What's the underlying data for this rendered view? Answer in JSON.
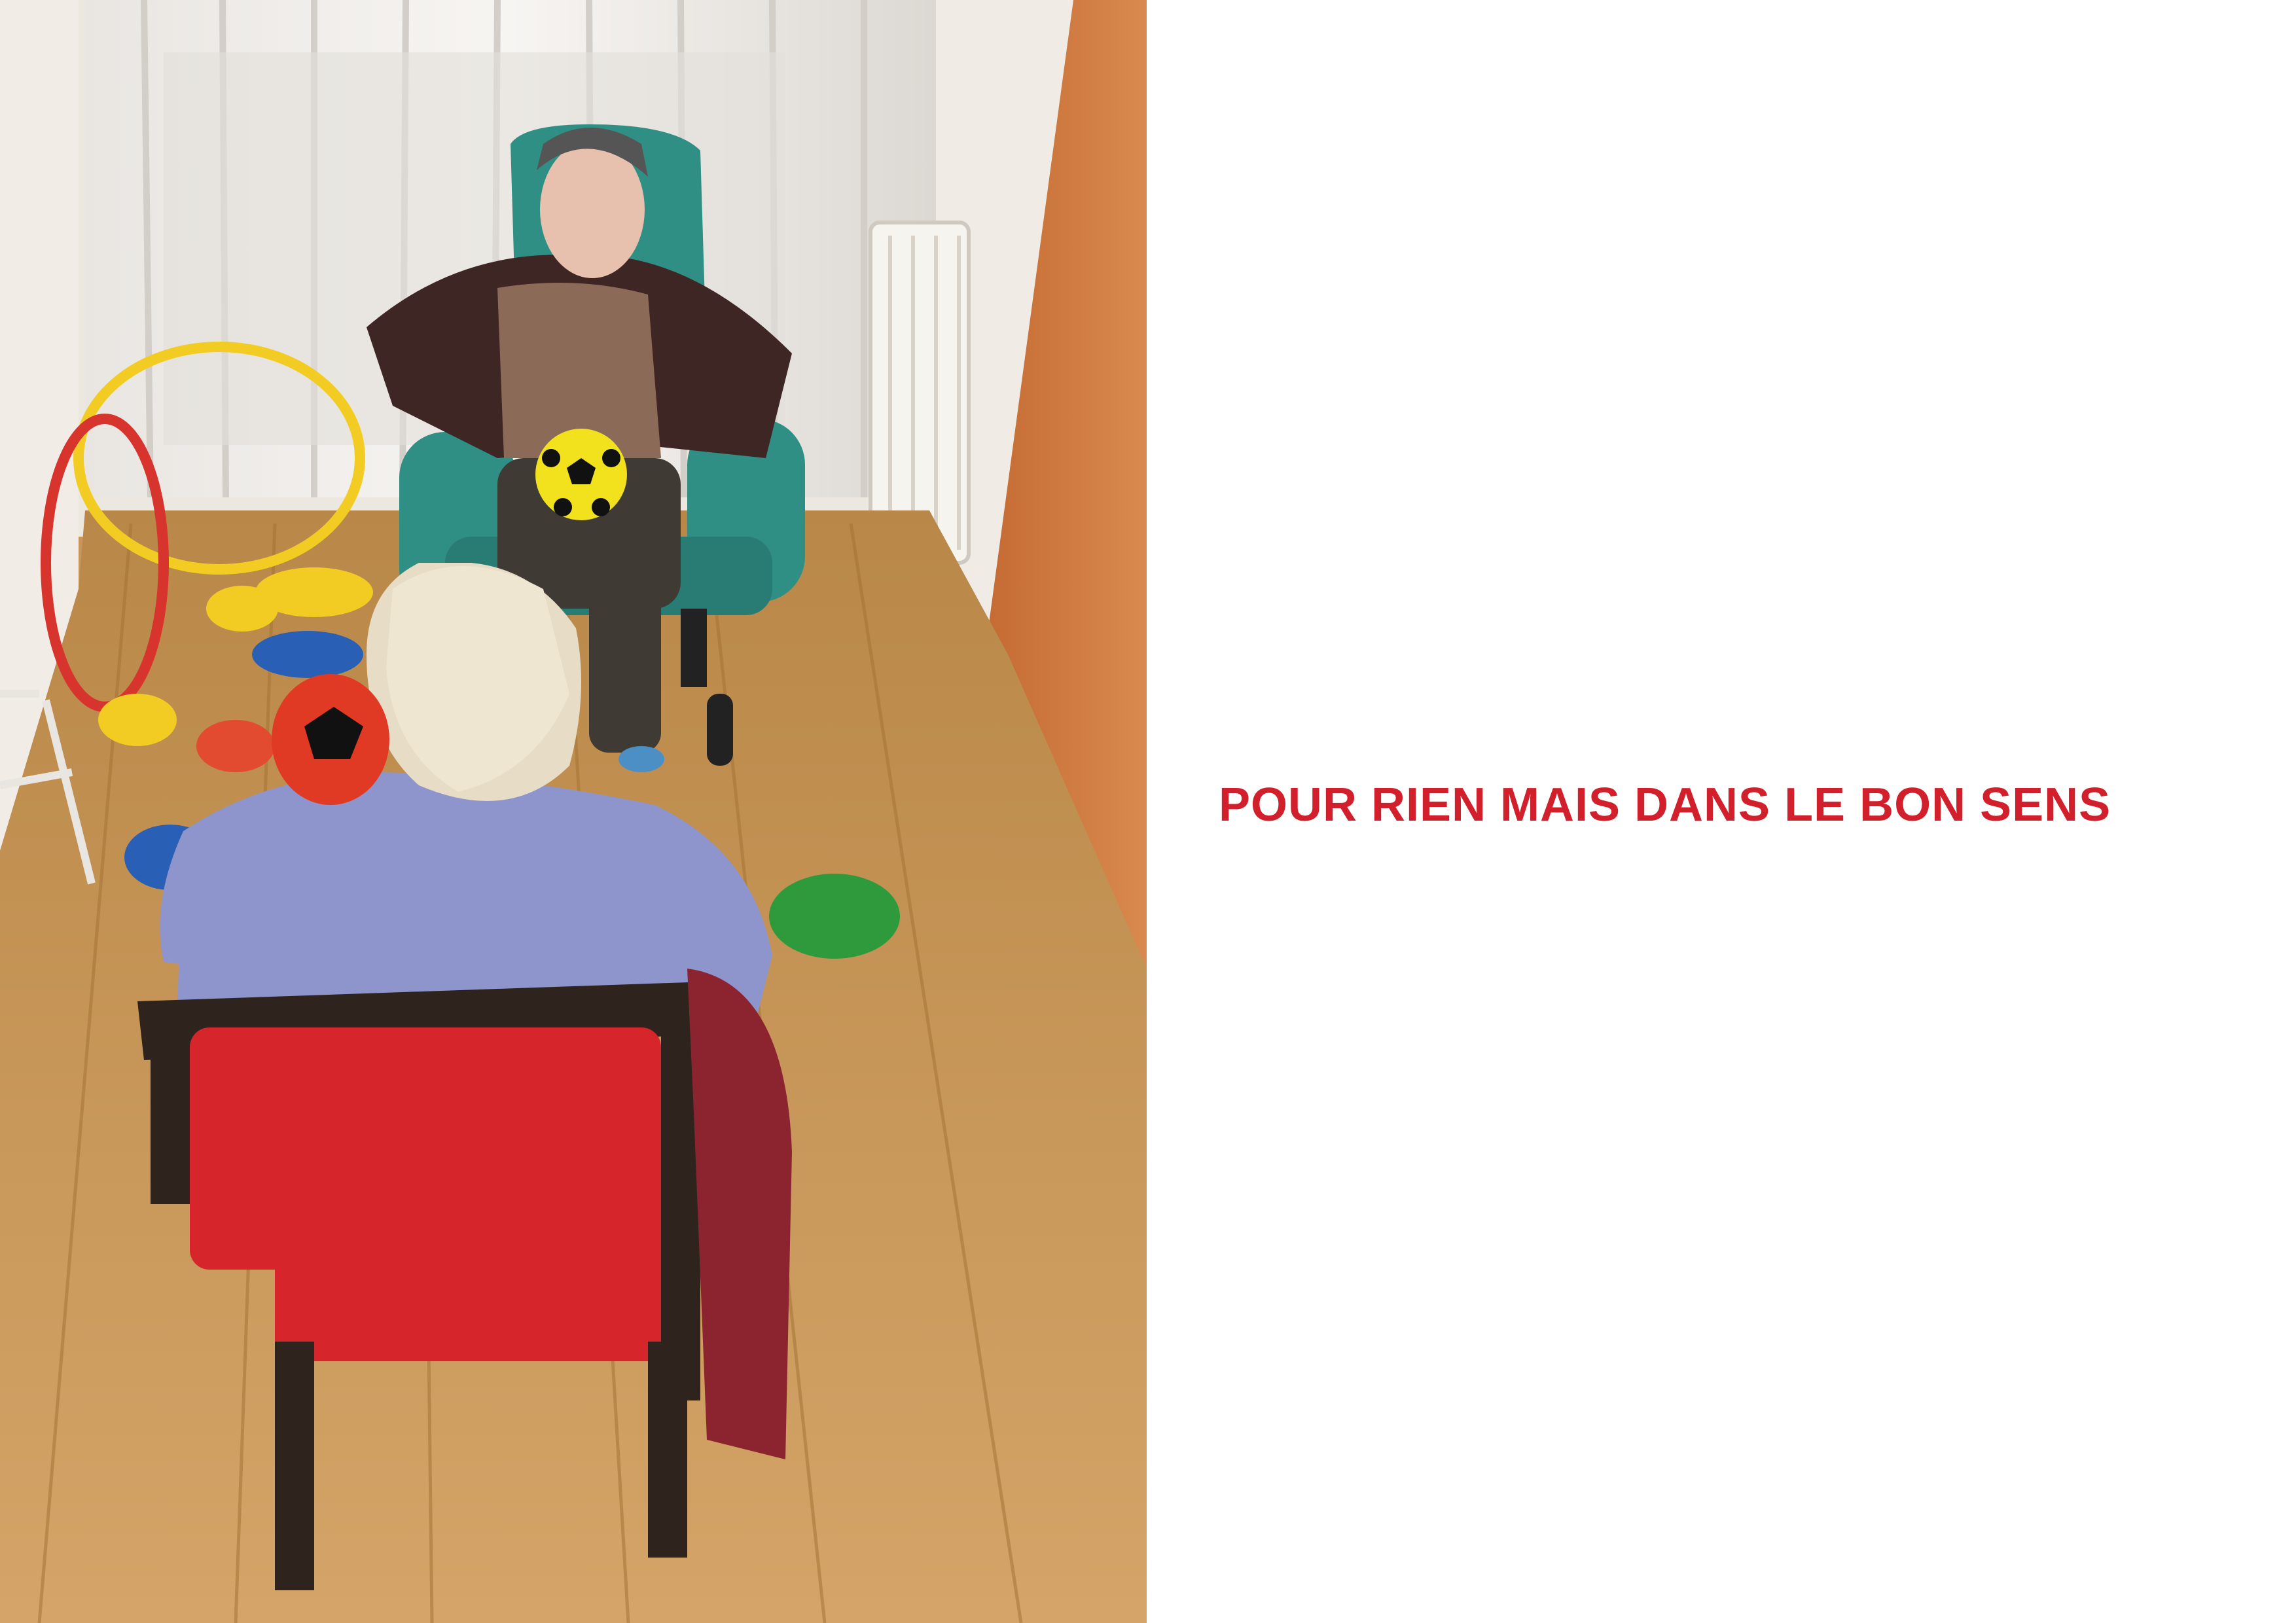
{
  "caption": {
    "text": "POUR RIEN MAIS DANS LE BON SENS",
    "color": "#d11f2b"
  },
  "photo": {
    "icon": "photograph-of-seniors-ball-activity"
  }
}
